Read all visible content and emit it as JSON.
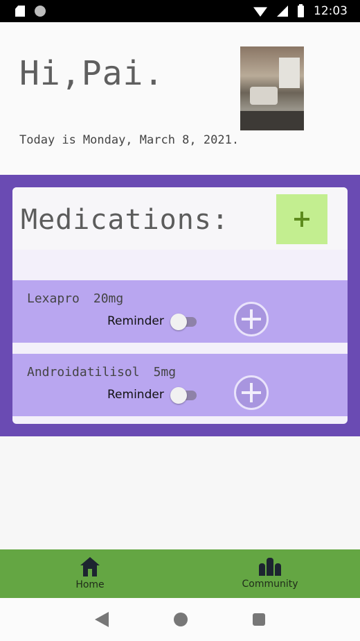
{
  "status_bar": {
    "time": "12:03",
    "icons": [
      "sd-card-icon",
      "circle-icon",
      "wifi-icon",
      "signal-icon",
      "battery-icon"
    ]
  },
  "header": {
    "greeting": "Hi,Pai.",
    "today_prefix": "Today is",
    "date": "Monday, March 8, 2021."
  },
  "medications": {
    "title": "Medications:",
    "add_icon": "plus-icon",
    "items": [
      {
        "name": "Lexapro",
        "dose": "20mg",
        "reminder_label": "Reminder",
        "reminder_on": false
      },
      {
        "name": "Androidatilisol",
        "dose": "5mg",
        "reminder_label": "Reminder",
        "reminder_on": false
      }
    ]
  },
  "bottom_nav": {
    "items": [
      {
        "label": "Home",
        "icon": "home-icon"
      },
      {
        "label": "Community",
        "icon": "community-icon"
      }
    ]
  },
  "colors": {
    "panel": "#6a4bb3",
    "item": "#b9a6f0",
    "add_button": "#c3ee90",
    "nav": "#64a643"
  }
}
